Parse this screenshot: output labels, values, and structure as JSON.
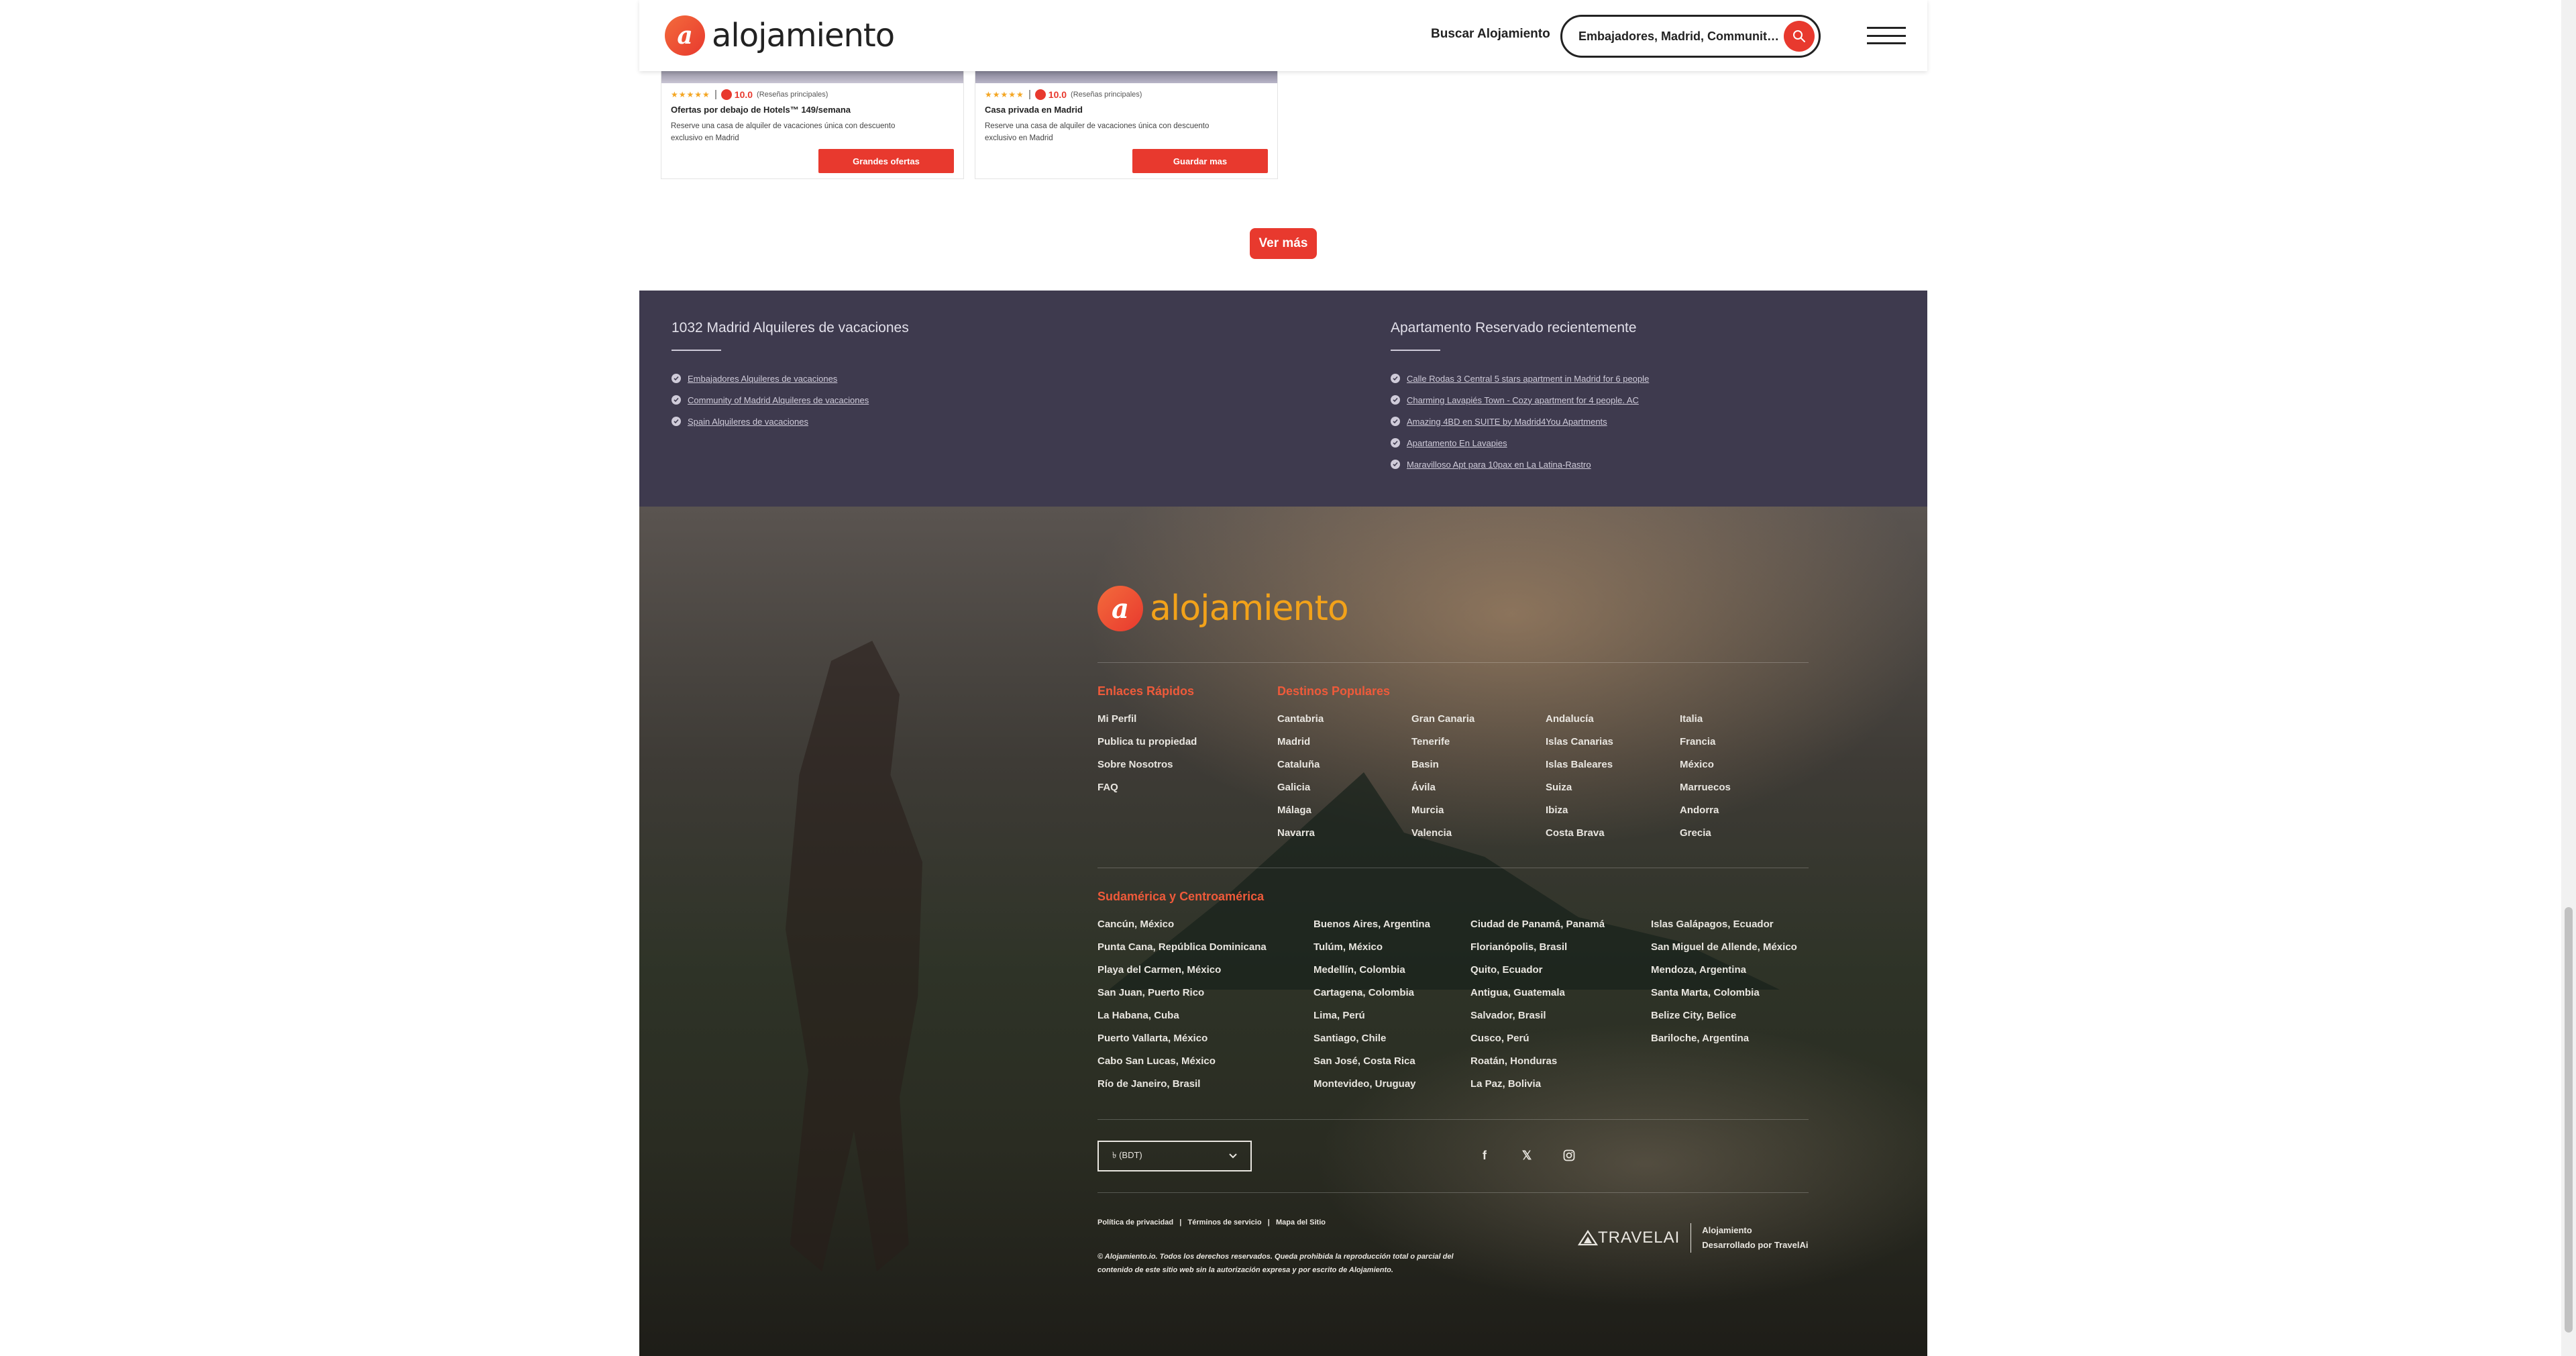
{
  "header": {
    "logo_text": "alojamiento",
    "logo_mark": "a",
    "nav_link": "Buscar Alojamiento",
    "search_value": "Embajadores, Madrid, Community of ..."
  },
  "cards": [
    {
      "stars": "★★★★★",
      "score": "10.0",
      "reviews": "(Reseñas principales)",
      "title": "Ofertas por debajo de Hotels™ 149/semana",
      "description": "Reserve una casa de alquiler de vacaciones única con descuento exclusivo en Madrid",
      "button": "Grandes ofertas"
    },
    {
      "stars": "★★★★★",
      "score": "10.0",
      "reviews": "(Reseñas principales)",
      "title": "Casa privada en Madrid",
      "description": "Reserve una casa de alquiler de vacaciones única con descuento exclusivo en Madrid",
      "button": "Guardar mas"
    }
  ],
  "ver_mas": "Ver más",
  "listing": {
    "left_title": "1032 Madrid Alquileres de vacaciones",
    "left_links": [
      "Embajadores Alquileres de vacaciones",
      "Community of Madrid Alquileres de vacaciones",
      "Spain Alquileres de vacaciones"
    ],
    "right_title": "Apartamento Reservado recientemente",
    "right_links": [
      "Calle Rodas 3 Central 5 stars apartment in Madrid for 6 people",
      "Charming Lavapiés Town - Cozy apartment for 4 people. AC",
      "Amazing 4BD en SUITE by Madrid4You Apartments",
      "Apartamento En Lavapies",
      "Maravilloso Apt para 10pax en La Latina-Rastro"
    ]
  },
  "footer": {
    "logo_text": "alojamiento",
    "quick_links_title": "Enlaces Rápidos",
    "quick_links": [
      "Mi Perfil",
      "Publica tu propiedad",
      "Sobre Nosotros",
      "FAQ"
    ],
    "popular_title": "Destinos Populares",
    "popular_cols": [
      [
        "Cantabria",
        "Madrid",
        "Cataluña",
        "Galicia",
        "Málaga",
        "Navarra"
      ],
      [
        "Gran Canaria",
        "Tenerife",
        "Basin",
        "Ávila",
        "Murcia",
        "Valencia"
      ],
      [
        "Andalucía",
        "Islas Canarias",
        "Islas Baleares",
        "Suiza",
        "Ibiza",
        "Costa Brava"
      ],
      [
        "Italia",
        "Francia",
        "México",
        "Marruecos",
        "Andorra",
        "Grecia"
      ]
    ],
    "south_title": "Sudamérica y Centroamérica",
    "south_cols": [
      [
        "Cancún, México",
        "Punta Cana, República Dominicana",
        "Playa del Carmen, México",
        "San Juan, Puerto Rico",
        "La Habana, Cuba",
        "Puerto Vallarta, México",
        "Cabo San Lucas, México",
        "Río de Janeiro, Brasil"
      ],
      [
        "Buenos Aires, Argentina",
        "Tulúm, México",
        "Medellín, Colombia",
        "Cartagena, Colombia",
        "Lima, Perú",
        "Santiago, Chile",
        "San José, Costa Rica",
        "Montevideo, Uruguay"
      ],
      [
        "Ciudad de Panamá, Panamá",
        "Florianópolis, Brasil",
        "Quito, Ecuador",
        "Antigua, Guatemala",
        "Salvador, Brasil",
        "Cusco, Perú",
        "Roatán, Honduras",
        "La Paz, Bolivia"
      ],
      [
        "Islas Galápagos, Ecuador",
        "San Miguel de Allende, México",
        "Mendoza, Argentina",
        "Santa Marta, Colombia",
        "Belize City, Belice",
        "Bariloche, Argentina"
      ]
    ],
    "currency": "৳ (BDT)",
    "social_icons": [
      "facebook-icon",
      "x-icon",
      "instagram-icon"
    ],
    "legal_links": [
      "Política de privacidad",
      "Términos de servicio",
      "Mapa del Sitio"
    ],
    "copyright": "© Alojamiento.io. Todos los derechos reservados. Queda prohibida la reproducción total o parcial del contenido de este sitio web sin la autorización expresa y por escrito de Alojamiento.",
    "travelai_logo": "TRAVELAI",
    "travelai_brand": "Alojamiento",
    "travelai_credit": "Desarrollado por TravelAi"
  },
  "colors": {
    "accent": "#e8392e",
    "listing_bg": "#3e3a4e",
    "footer_link": "#e9e6e0",
    "footer_heading": "#ef5a3a",
    "footer_logo": "#f2a21a"
  }
}
